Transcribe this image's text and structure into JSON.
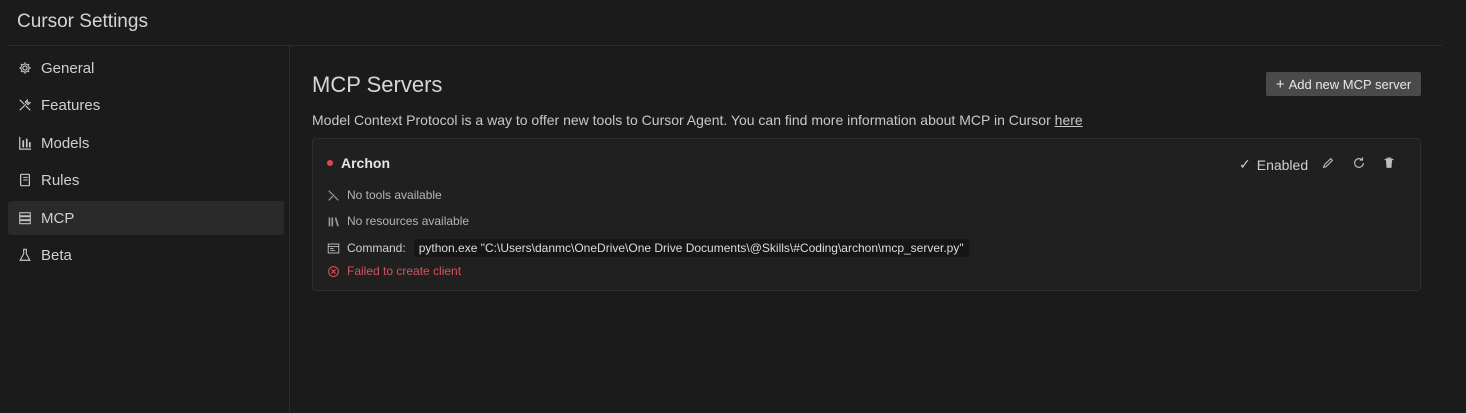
{
  "header": {
    "title": "Cursor Settings"
  },
  "sidebar": {
    "items": [
      {
        "label": "General",
        "icon": "gear-icon"
      },
      {
        "label": "Features",
        "icon": "tools-icon"
      },
      {
        "label": "Models",
        "icon": "bar-chart-icon"
      },
      {
        "label": "Rules",
        "icon": "notebook-icon"
      },
      {
        "label": "MCP",
        "icon": "server-icon",
        "active": true
      },
      {
        "label": "Beta",
        "icon": "flask-icon"
      }
    ]
  },
  "main": {
    "title": "MCP Servers",
    "add_button_label": "Add new MCP server",
    "description": "Model Context Protocol is a way to offer new tools to Cursor Agent. You can find more information about MCP in Cursor",
    "description_link": "here",
    "servers": [
      {
        "name": "Archon",
        "status_color": "#e0474c",
        "enabled_label": "Enabled",
        "tools_text": "No tools available",
        "resources_text": "No resources available",
        "command_label": "Command:",
        "command_value": "python.exe \"C:\\Users\\danmc\\OneDrive\\One Drive Documents\\@Skills\\#Coding\\archon\\mcp_server.py\"",
        "error_text": "Failed to create client"
      }
    ]
  },
  "colors": {
    "background": "#1b1b1b",
    "active_nav": "#2a2a2a",
    "error": "#d9525a",
    "status_error_dot": "#e0474c",
    "button_bg": "#4a4a4a"
  }
}
